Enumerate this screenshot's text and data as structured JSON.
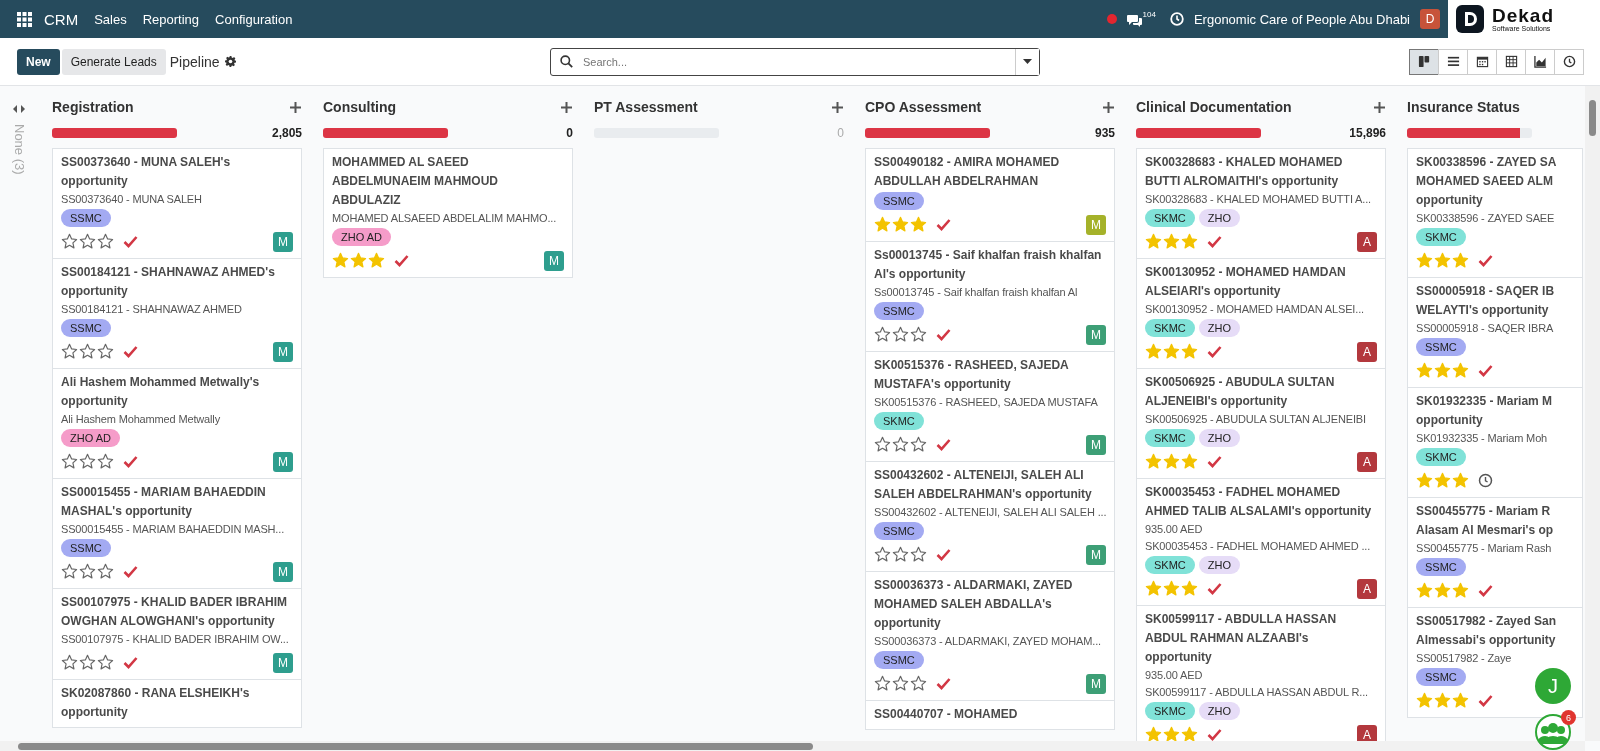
{
  "navbar": {
    "brand": "CRM",
    "menu": [
      "Sales",
      "Reporting",
      "Configuration"
    ],
    "messages_count": "104",
    "company": "Ergonomic Care of People Abu Dhabi",
    "user_initial": "D",
    "logo": {
      "name": "Dekad",
      "tagline": "Software Solutions"
    }
  },
  "control_panel": {
    "new_button": "New",
    "generate_button": "Generate Leads",
    "breadcrumb": "Pipeline",
    "search": {
      "placeholder": "Search..."
    },
    "views": [
      {
        "kind": "kanban",
        "selected": true
      },
      {
        "kind": "list",
        "selected": false
      },
      {
        "kind": "calendar",
        "selected": false
      },
      {
        "kind": "pivot",
        "selected": false
      },
      {
        "kind": "graph",
        "selected": false
      },
      {
        "kind": "activity",
        "selected": false
      }
    ]
  },
  "folded_column": {
    "label": "None (3)"
  },
  "columns": [
    {
      "title": "Registration",
      "level": 1,
      "count": "2,805",
      "count_muted": false,
      "cards": [
        {
          "title": "SS00373640 - MUNA SALEH's opportunity",
          "subtitle": "SS00373640 - MUNA SALEH",
          "tags": [
            {
              "label": "SSMC",
              "color": "#a3aaf2"
            }
          ],
          "stars": 0,
          "activity_done": true,
          "avatar": {
            "letter": "M",
            "color": "#2e9e8e"
          }
        },
        {
          "title": "SS00184121 - SHAHNAWAZ AHMED's opportunity",
          "subtitle": "SS00184121 - SHAHNAWAZ AHMED",
          "tags": [
            {
              "label": "SSMC",
              "color": "#a3aaf2"
            }
          ],
          "stars": 0,
          "activity_done": true,
          "avatar": {
            "letter": "M",
            "color": "#2e9e8e"
          }
        },
        {
          "title": "Ali Hashem Mohammed Metwally's opportunity",
          "subtitle": "Ali Hashem Mohammed Metwally",
          "tags": [
            {
              "label": "ZHO AD",
              "color": "#f59cc9"
            }
          ],
          "stars": 0,
          "activity_done": true,
          "avatar": {
            "letter": "M",
            "color": "#2e9e8e"
          }
        },
        {
          "title": "SS00015455 - MARIAM BAHAEDDIN MASHAL's opportunity",
          "subtitle": "SS00015455 - MARIAM BAHAEDDIN MASH...",
          "tags": [
            {
              "label": "SSMC",
              "color": "#a3aaf2"
            }
          ],
          "stars": 0,
          "activity_done": true,
          "avatar": {
            "letter": "M",
            "color": "#2e9e8e"
          }
        },
        {
          "title": "SS00107975 - KHALID BADER IBRAHIM OWGHAN ALOWGHANI's opportunity",
          "subtitle": "SS00107975 - KHALID BADER IBRAHIM OW...",
          "stars": 0,
          "activity_done": true,
          "avatar": {
            "letter": "M",
            "color": "#2e9e8e"
          }
        },
        {
          "title": "SK02087860 - RANA ELSHEIKH's opportunity"
        }
      ]
    },
    {
      "title": "Consulting",
      "level": 1,
      "count": "0",
      "count_muted": false,
      "cards": [
        {
          "title": "MOHAMMED AL SAEED ABDELMUNAEIM MAHMOUD ABDULAZIZ",
          "subtitle": "MOHAMED ALSAEED ABDELALIM MAHMO...",
          "tags": [
            {
              "label": "ZHO AD",
              "color": "#f59cc9"
            }
          ],
          "stars": 3,
          "activity_done": true,
          "avatar": {
            "letter": "M",
            "color": "#2e9e8e"
          }
        }
      ]
    },
    {
      "title": "PT Assessment",
      "level": 0,
      "count": "0",
      "count_muted": true
    },
    {
      "title": "CPO Assessment",
      "level": 1,
      "count": "935",
      "count_muted": false,
      "cards": [
        {
          "title": "SS00490182 - AMIRA MOHAMED ABDULLAH ABDELRAHMAN",
          "tags": [
            {
              "label": "SSMC",
              "color": "#a3aaf2"
            }
          ],
          "stars": 3,
          "activity_done": true,
          "avatar": {
            "letter": "M",
            "color": "#a5b22a"
          }
        },
        {
          "title": "Ss00013745 - Saif khalfan fraish khalfan Al's opportunity",
          "subtitle": "Ss00013745 - Saif khalfan fraish khalfan Al",
          "tags": [
            {
              "label": "SSMC",
              "color": "#a3aaf2"
            }
          ],
          "stars": 0,
          "activity_done": true,
          "avatar": {
            "letter": "M",
            "color": "#3d9f76"
          }
        },
        {
          "title": "SK00515376 - RASHEED, SAJEDA MUSTAFA's opportunity",
          "subtitle": "SK00515376 - RASHEED, SAJEDA MUSTAFA",
          "tags": [
            {
              "label": "SKMC",
              "color": "#80e2d8"
            }
          ],
          "stars": 0,
          "activity_done": true,
          "avatar": {
            "letter": "M",
            "color": "#3d9f76"
          }
        },
        {
          "title": "SS00432602 - ALTENEIJI, SALEH ALI SALEH ABDELRAHMAN's opportunity",
          "subtitle": "SS00432602 - ALTENEIJI, SALEH ALI SALEH ...",
          "tags": [
            {
              "label": "SSMC",
              "color": "#a3aaf2"
            }
          ],
          "stars": 0,
          "activity_done": true,
          "avatar": {
            "letter": "M",
            "color": "#3d9f76"
          }
        },
        {
          "title": "SS00036373 - ALDARMAKI, ZAYED MOHAMED SALEH ABDALLA's opportunity",
          "subtitle": "SS00036373 - ALDARMAKI, ZAYED MOHAM...",
          "tags": [
            {
              "label": "SSMC",
              "color": "#a3aaf2"
            }
          ],
          "stars": 0,
          "activity_done": true,
          "avatar": {
            "letter": "M",
            "color": "#3d9f76"
          }
        },
        {
          "title": "SS00440707 - MOHAMED"
        }
      ]
    },
    {
      "title": "Clinical Documentation",
      "level": 1,
      "count": "15,896",
      "count_muted": false,
      "cards": [
        {
          "title": "SK00328683 - KHALED MOHAMED BUTTI ALROMAITHI's opportunity",
          "subtitle": "SK00328683 - KHALED MOHAMED BUTTI A...",
          "tags": [
            {
              "label": "SKMC",
              "color": "#80e2d8"
            },
            {
              "label": "ZHO",
              "color": "#e6dcf7"
            }
          ],
          "stars": 3,
          "activity_done": true,
          "avatar": {
            "letter": "A",
            "color": "#b3383d"
          }
        },
        {
          "title": "SK00130952 - MOHAMED HAMDAN ALSEIARI's opportunity",
          "subtitle": "SK00130952 - MOHAMED HAMDAN ALSEI...",
          "tags": [
            {
              "label": "SKMC",
              "color": "#80e2d8"
            },
            {
              "label": "ZHO",
              "color": "#e6dcf7"
            }
          ],
          "stars": 3,
          "activity_done": true,
          "avatar": {
            "letter": "A",
            "color": "#b3383d"
          }
        },
        {
          "title": "SK00506925 - ABUDULA SULTAN ALJENEIBI's opportunity",
          "subtitle": "SK00506925 - ABUDULA SULTAN ALJENEIBI",
          "tags": [
            {
              "label": "SKMC",
              "color": "#80e2d8"
            },
            {
              "label": "ZHO",
              "color": "#e6dcf7"
            }
          ],
          "stars": 3,
          "activity_done": true,
          "avatar": {
            "letter": "A",
            "color": "#b3383d"
          }
        },
        {
          "title": "SK00035453 - FADHEL MOHAMED AHMED TALIB ALSALAMI's opportunity",
          "amount": "935.00 AED",
          "subtitle": "SK00035453 - FADHEL MOHAMED AHMED ...",
          "tags": [
            {
              "label": "SKMC",
              "color": "#80e2d8"
            },
            {
              "label": "ZHO",
              "color": "#e6dcf7"
            }
          ],
          "stars": 3,
          "activity_done": true,
          "avatar": {
            "letter": "A",
            "color": "#b3383d"
          }
        },
        {
          "title": "SK00599117 - ABDULLA HASSAN ABDUL RAHMAN ALZAABI's opportunity",
          "amount": "935.00 AED",
          "subtitle": "SK00599117 - ABDULLA HASSAN ABDUL R...",
          "tags": [
            {
              "label": "SKMC",
              "color": "#80e2d8"
            },
            {
              "label": "ZHO",
              "color": "#e6dcf7"
            }
          ],
          "stars": 3,
          "activity_done": true,
          "avatar": {
            "letter": "A",
            "color": "#b3383d"
          }
        }
      ]
    },
    {
      "title": "Insurance Status",
      "level": 0.9,
      "cards": [
        {
          "title": "SK00338596 - ZAYED SA\nMOHAMED SAEED ALM\nopportunity",
          "subtitle": "SK00338596 - ZAYED SAEE",
          "tags": [
            {
              "label": "SKMC",
              "color": "#80e2d8"
            }
          ],
          "stars": 3,
          "activity_done": true
        },
        {
          "title": "SS00005918 - SAQER IB\nWELAYTI's opportunity",
          "subtitle": "SS00005918 - SAQER IBRA",
          "tags": [
            {
              "label": "SSMC",
              "color": "#a3aaf2"
            }
          ],
          "stars": 3,
          "activity_done": true
        },
        {
          "title": "SK01932335 - Mariam M\nopportunity",
          "subtitle": "SK01932335 - Mariam Moh",
          "tags": [
            {
              "label": "SKMC",
              "color": "#80e2d8"
            }
          ],
          "stars": 3,
          "activity_done": false
        },
        {
          "title": "SS00455775 - Mariam R\nAlasam Al Mesmari's op",
          "subtitle": "SS00455775 - Mariam Rash",
          "tags": [
            {
              "label": "SSMC",
              "color": "#a3aaf2"
            }
          ],
          "stars": 3,
          "activity_done": true
        },
        {
          "title": "SS00517982 - Zayed San\nAlmessabi's opportunity",
          "subtitle": "SS00517982 - Zaye",
          "tags": [
            {
              "label": "SSMC",
              "color": "#a3aaf2"
            }
          ],
          "stars": 3,
          "activity_done": true
        }
      ]
    }
  ],
  "floating": {
    "user_initial": "J",
    "badge": "6"
  }
}
